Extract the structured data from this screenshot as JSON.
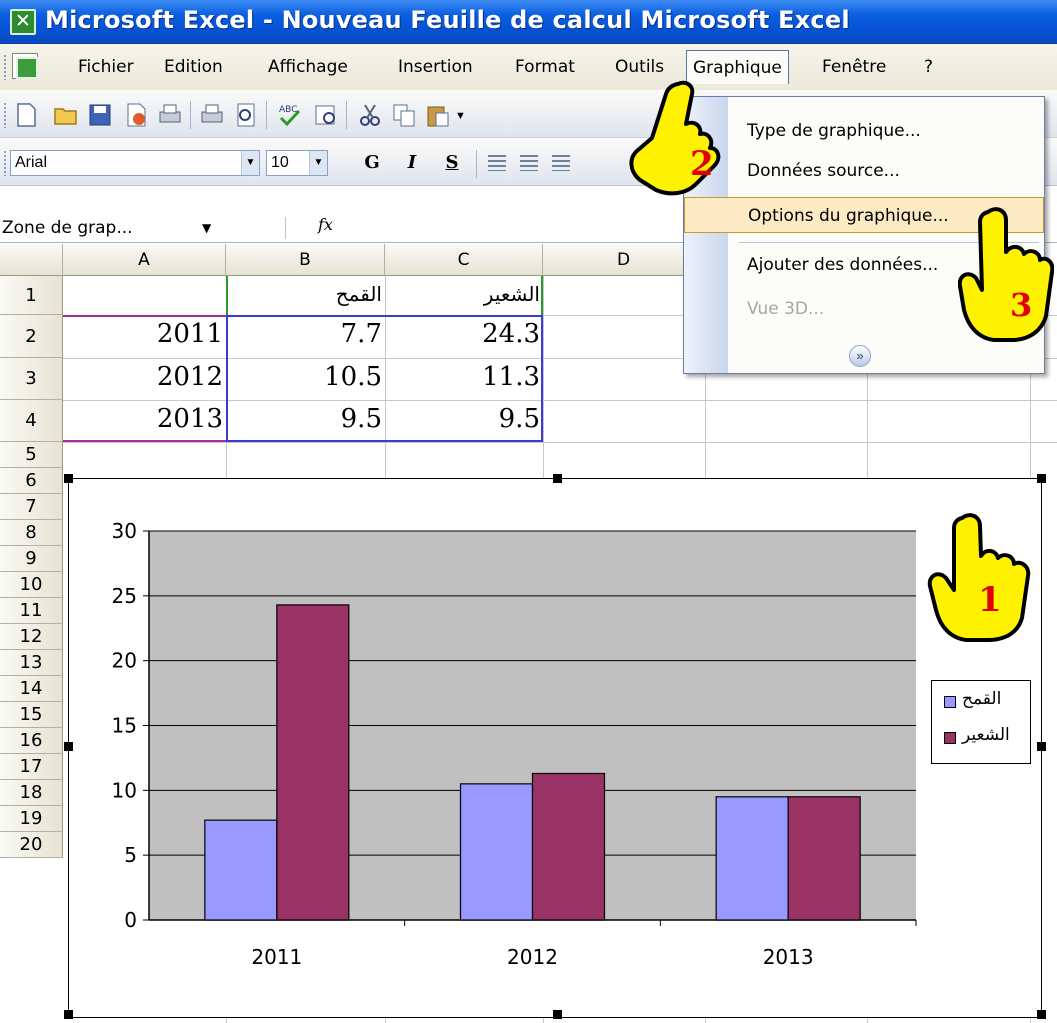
{
  "window": {
    "title": "Microsoft Excel - Nouveau Feuille de calcul Microsoft Excel"
  },
  "menubar": {
    "items": [
      "Fichier",
      "Edition",
      "Affichage",
      "Insertion",
      "Format",
      "Outils",
      "Graphique",
      "Fenêtre",
      "?"
    ],
    "active": "Graphique"
  },
  "formatting": {
    "font": "Arial",
    "size": "10",
    "bold": "G",
    "italic": "I",
    "underline": "S"
  },
  "formula_bar": {
    "name_box": "Zone de grap...",
    "fx": "fx",
    "content": ""
  },
  "sheet": {
    "columns": [
      "A",
      "B",
      "C",
      "D"
    ],
    "rows": [
      "1",
      "2",
      "3",
      "4",
      "5",
      "6",
      "7",
      "8",
      "9",
      "10",
      "11",
      "12",
      "13",
      "14",
      "15",
      "16",
      "17",
      "18",
      "19",
      "20"
    ],
    "headers": [
      "",
      "القمح",
      "الشعير"
    ],
    "data": [
      [
        "2011",
        "7.7",
        "24.3"
      ],
      [
        "2012",
        "10.5",
        "11.3"
      ],
      [
        "2013",
        "9.5",
        "9.5"
      ]
    ]
  },
  "chart_data": {
    "type": "bar",
    "categories": [
      "2011",
      "2012",
      "2013"
    ],
    "series": [
      {
        "name": "القمح",
        "values": [
          7.7,
          10.5,
          9.5
        ],
        "color": "#9999ff"
      },
      {
        "name": "الشعير",
        "values": [
          24.3,
          11.3,
          9.5
        ],
        "color": "#993366"
      }
    ],
    "ylim": [
      0,
      30
    ],
    "yticks": [
      "0",
      "5",
      "10",
      "15",
      "20",
      "25",
      "30"
    ],
    "grid": true,
    "plot_background": "#c0c0c0",
    "legend": "right",
    "title": "",
    "xlabel": "",
    "ylabel": ""
  },
  "dropdown": {
    "items": [
      {
        "label": "Type de graphique...",
        "state": "normal"
      },
      {
        "label": "Données source...",
        "state": "normal"
      },
      {
        "label": "Options du graphique...",
        "state": "hover"
      },
      {
        "label": "Ajouter des données...",
        "state": "normal"
      },
      {
        "label": "Vue 3D...",
        "state": "disabled"
      }
    ],
    "expand_icon": "chevron-double-down-icon"
  },
  "annotations": {
    "steps": [
      "1",
      "2",
      "3"
    ],
    "hand_color": "#fff200",
    "number_color": "#e00000"
  }
}
